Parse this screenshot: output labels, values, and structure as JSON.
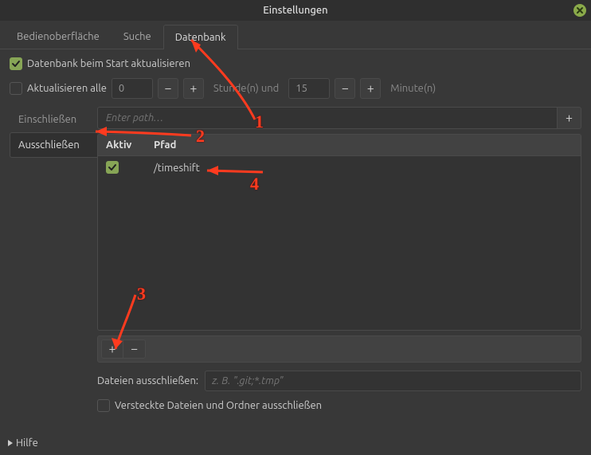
{
  "window": {
    "title": "Einstellungen"
  },
  "tabs": {
    "interface": "Bedienoberfläche",
    "search": "Suche",
    "database": "Datenbank"
  },
  "db": {
    "update_on_start": "Datenbank beim Start aktualisieren",
    "update_every": "Aktualisieren alle",
    "hours_value": "0",
    "hours_unit": "Stunde(n) und",
    "minutes_value": "15",
    "minutes_unit": "Minute(n)"
  },
  "side": {
    "include": "Einschließen",
    "exclude": "Ausschließen"
  },
  "path": {
    "placeholder": "Enter path…"
  },
  "table": {
    "col_active": "Aktiv",
    "col_path": "Pfad",
    "rows": [
      {
        "active": true,
        "path": "/timeshift"
      }
    ]
  },
  "excludefiles": {
    "label": "Dateien ausschließen:",
    "placeholder": "z. B. \".git;*.tmp\""
  },
  "hidden": {
    "label": "Versteckte Dateien und Ordner ausschließen"
  },
  "help": "Hilfe",
  "icons": {
    "plus": "+",
    "minus": "−"
  },
  "annotations": {
    "n1": "1",
    "n2": "2",
    "n3": "3",
    "n4": "4"
  }
}
